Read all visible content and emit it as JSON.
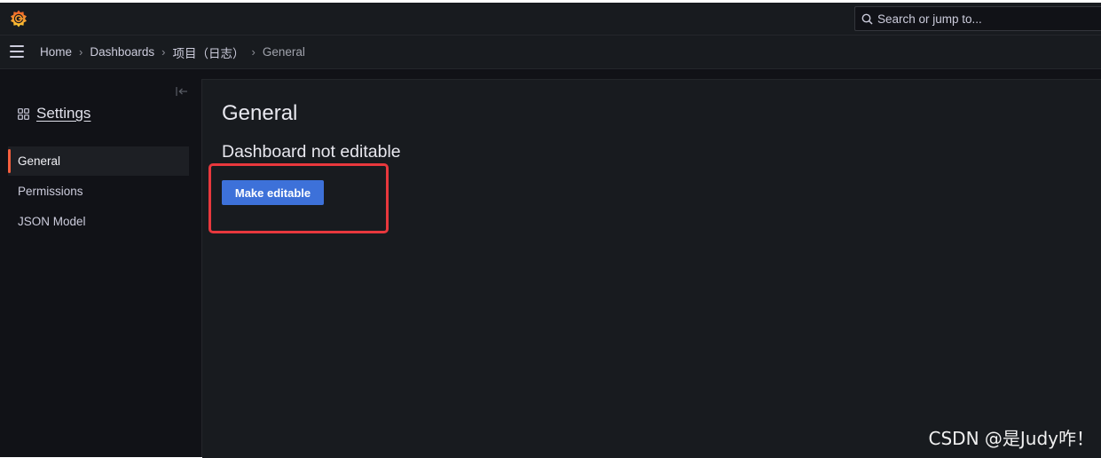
{
  "topbar": {
    "logo_icon": "grafana-logo-icon",
    "search_placeholder": "Search or jump to..."
  },
  "breadcrumbs": [
    {
      "label": "Home"
    },
    {
      "label": "Dashboards"
    },
    {
      "label": "项目（日志）"
    },
    {
      "label": "General"
    }
  ],
  "sidebar": {
    "title": "Settings",
    "items": [
      {
        "label": "General",
        "active": true
      },
      {
        "label": "Permissions",
        "active": false
      },
      {
        "label": "JSON Model",
        "active": false
      }
    ]
  },
  "main": {
    "title": "General",
    "subtitle": "Dashboard not editable",
    "button_label": "Make editable"
  },
  "watermark": "CSDN @是Judy咋！",
  "colors": {
    "accent_orange": "#f55f3e",
    "button_blue": "#3d71d9",
    "highlight_red": "#e8383d",
    "background": "#111217",
    "panel": "#181b1f"
  }
}
